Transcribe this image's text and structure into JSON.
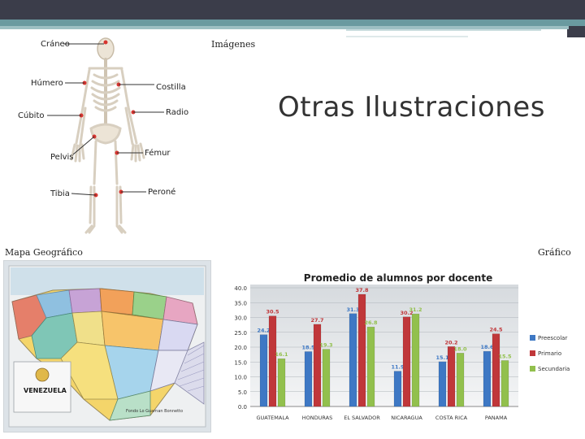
{
  "slide": {
    "title": "Otras Ilustraciones",
    "images_label": "Imágenes",
    "map_label": "Mapa Geográfico",
    "chart_label": "Gráfico"
  },
  "skeleton": {
    "labels": [
      "Cráneo",
      "Húmero",
      "Costilla",
      "Cúbito",
      "Radio",
      "Pelvis",
      "Fémur",
      "Tibia",
      "Peroné"
    ]
  },
  "map": {
    "country": "VENEZUELA",
    "credit": "Fondo Lo Guarnan Bonnetto"
  },
  "chart_data": {
    "type": "bar",
    "title": "Promedio de alumnos por docente",
    "categories": [
      "GUATEMALA",
      "HONDURAS",
      "EL SALVADOR",
      "NICARAGUA",
      "COSTA RICA",
      "PANAMA"
    ],
    "series": [
      {
        "name": "Preescolar",
        "color": "#3e78c4",
        "values": [
          24.2,
          18.5,
          31.3,
          11.9,
          15.1,
          18.6
        ]
      },
      {
        "name": "Primario",
        "color": "#c0373a",
        "values": [
          30.5,
          27.7,
          37.8,
          30.2,
          20.2,
          24.5
        ]
      },
      {
        "name": "Secundaria",
        "color": "#92c04d",
        "values": [
          16.1,
          19.3,
          26.8,
          31.2,
          18.0,
          15.5
        ]
      }
    ],
    "y_ticks": [
      "0.0",
      "5.0",
      "10.0",
      "15.0",
      "20.0",
      "25.0",
      "30.0",
      "35.0",
      "40.0"
    ],
    "ylim": [
      0,
      40
    ],
    "legend": "right",
    "grid": true
  }
}
